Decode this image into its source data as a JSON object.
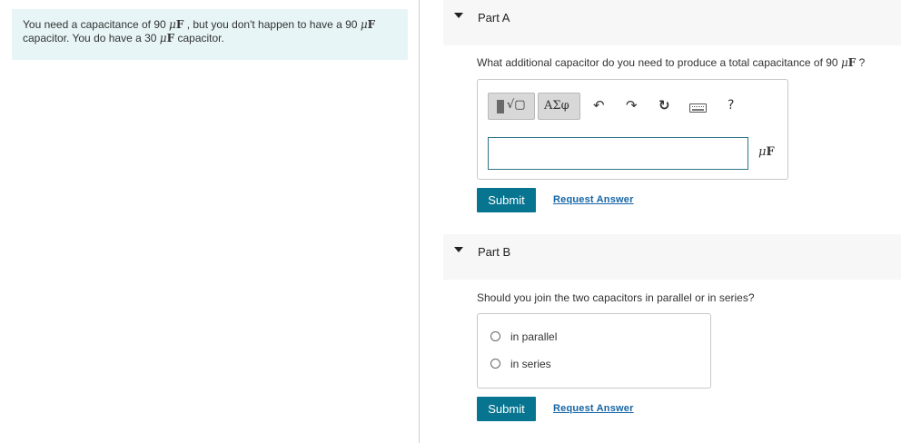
{
  "intro": {
    "text_a": "You need a capacitance of 90 ",
    "unit_mu": "μ",
    "unit_F": "F",
    "text_b": " , but you don't happen to have a 90 ",
    "text_c": "capacitor. You do have a 30 ",
    "text_d": " capacitor."
  },
  "part_a": {
    "title": "Part A",
    "question_prefix": "What additional capacitor do you need to produce a total capacitance of 90 ",
    "question_suffix": " ?",
    "toolbar": {
      "templates_symbol": "√▢",
      "greek_label": "ΑΣφ",
      "undo_icon": "↶",
      "redo_icon": "↷",
      "reset_icon": "↻",
      "help_label": "?"
    },
    "answer_value": "",
    "unit_label": "μF",
    "submit_label": "Submit",
    "request_label": "Request Answer"
  },
  "part_b": {
    "title": "Part B",
    "question": "Should you join the two capacitors in parallel or in series?",
    "options": [
      "in parallel",
      "in series"
    ],
    "submit_label": "Submit",
    "request_label": "Request Answer"
  }
}
